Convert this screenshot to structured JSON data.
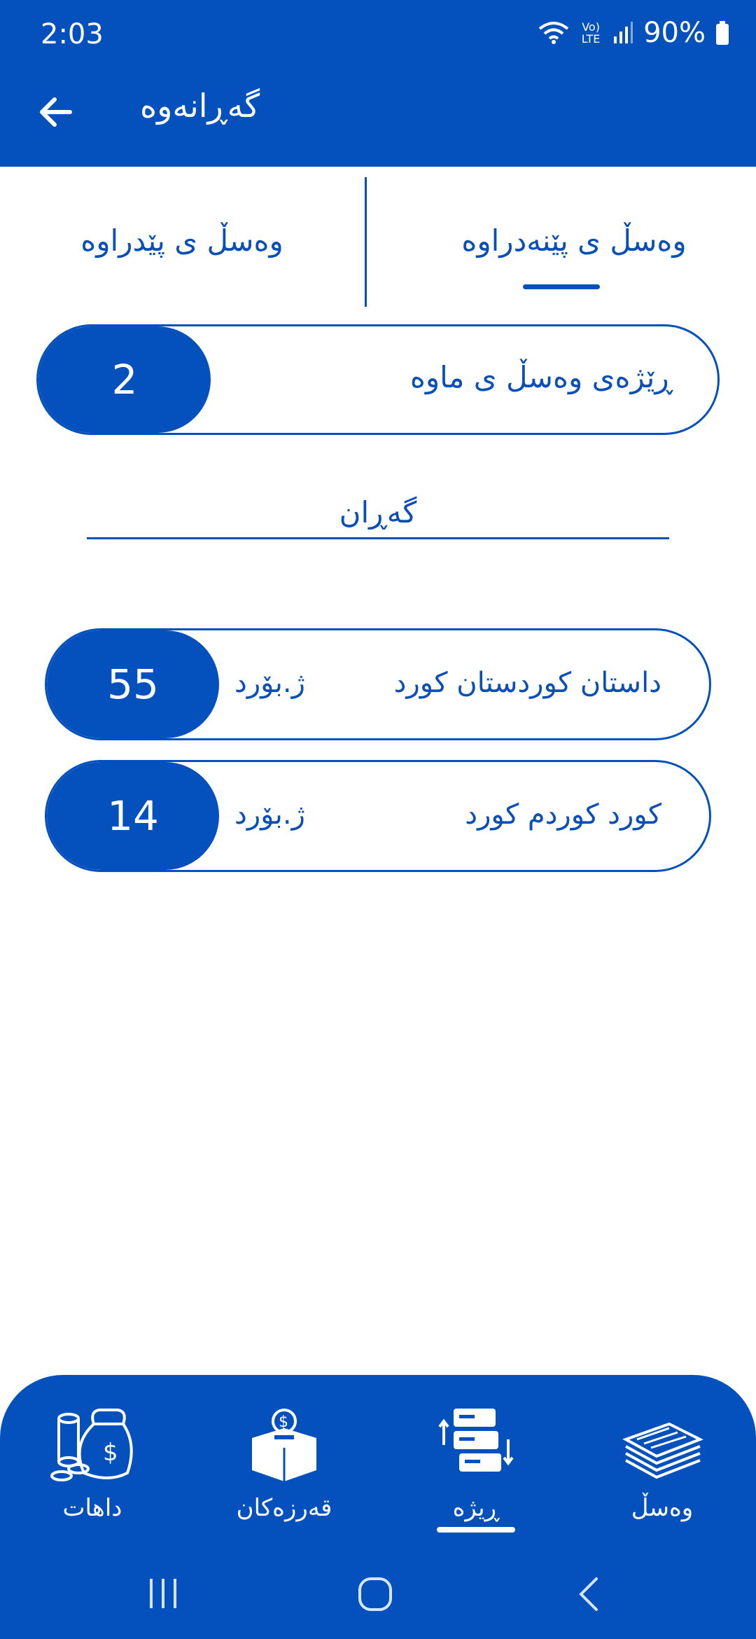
{
  "status_bar": {
    "time": "2:03",
    "battery": "90%",
    "network_label": "Vo) LTE"
  },
  "app_bar": {
    "title": "گەڕانەوە"
  },
  "tabs": [
    {
      "label": "وەسڵ ی پێنەدراوە",
      "active": true
    },
    {
      "label": "وەسڵ ی پێدراوە",
      "active": false
    }
  ],
  "summary": {
    "label": "ڕێژەی وەسڵ ی ماوە",
    "count": "2"
  },
  "search": {
    "placeholder": "گەڕان"
  },
  "items": [
    {
      "name": "داستان کوردستان کورد",
      "unit": "ژ.بۆرد",
      "count": "55"
    },
    {
      "name": "کورد کوردم کورد",
      "unit": "ژ.بۆرد",
      "count": "14"
    }
  ],
  "bottom_nav": [
    {
      "label": "داهات",
      "icon": "money-bag-icon",
      "active": false
    },
    {
      "label": "قەرزەکان",
      "icon": "donation-box-icon",
      "active": false
    },
    {
      "label": "ڕیژە",
      "icon": "server-transfer-icon",
      "active": true
    },
    {
      "label": "وەسڵ",
      "icon": "paper-stack-icon",
      "active": false
    }
  ],
  "colors": {
    "primary": "#0450bd",
    "background": "#ffffff",
    "text": "#0a4fb8"
  }
}
